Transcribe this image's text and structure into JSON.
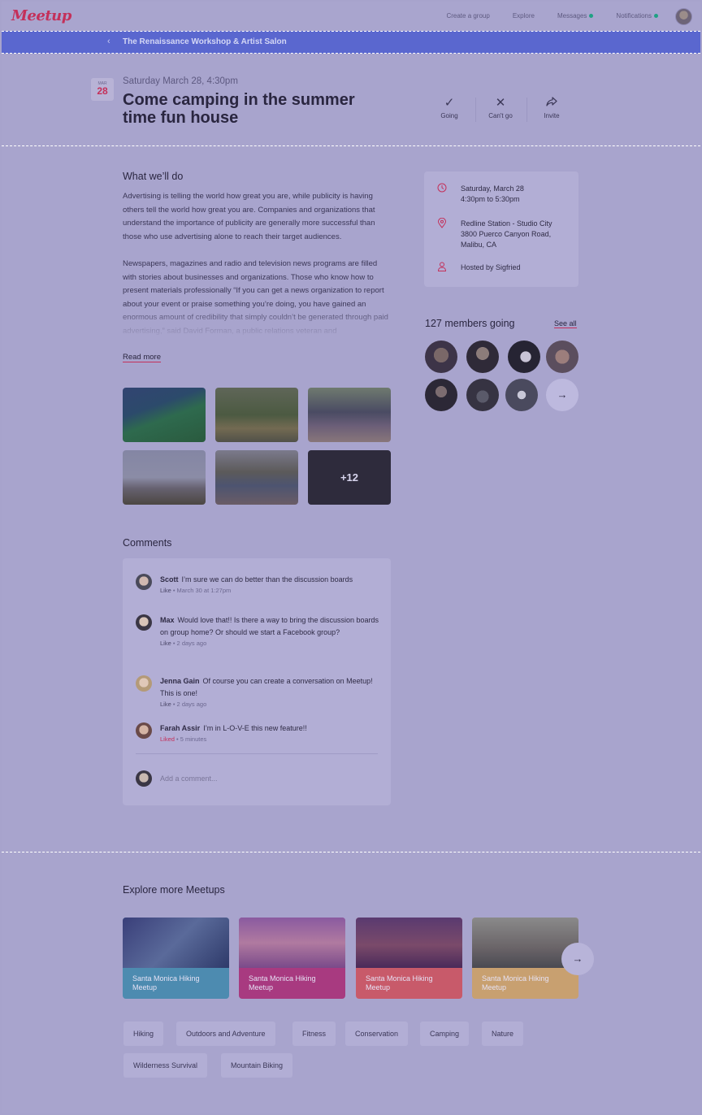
{
  "nav": {
    "logo": "Meetup",
    "links": [
      "Create a group",
      "Explore",
      "Messages",
      "Notifications"
    ]
  },
  "group": {
    "name": "The Renaissance Workshop & Artist Salon"
  },
  "event": {
    "cal_month": "MAR",
    "cal_day": "28",
    "date": "Saturday March 28, 4:30pm",
    "title": "Come camping in the summer time fun house",
    "rsvp": {
      "going": "Going",
      "cant_go": "Can't go",
      "invite": "Invite"
    }
  },
  "details": {
    "heading": "What we’ll do",
    "paragraphs": [
      "Advertising is telling the world how great you are, while publicity is having others tell the world how great you are. Companies and organizations that understand the importance of publicity are generally more successful than those who use advertising alone to reach their target audiences.",
      "Newspapers, magazines and radio and television news programs are filled with stories about businesses and organizations. Those who know how to present materials professionally “If you can get a news organization to report about your event or praise something you’re doing, you have gained an enormous amount of credibility that simply couldn’t be generated through paid advertising,” said David Forman, a public relations veteran and"
    ],
    "read_more": "Read more"
  },
  "photos": {
    "more_count": "+12"
  },
  "info": {
    "date_line1": "Saturday, March 28",
    "date_line2": "4:30pm to 5:30pm",
    "venue": "Redline Station - Studio City",
    "address1": "3800 Puerco Canyon Road,",
    "address2": "Malibu, CA",
    "host": "Hosted by Sigfried"
  },
  "members": {
    "heading": "127 members going",
    "see_all": "See all"
  },
  "comments": {
    "heading": "Comments",
    "items": [
      {
        "author": "Scott",
        "text": "I’m sure we can do better than the discussion boards",
        "like": "Like",
        "time": " • March 30 at 1:27pm"
      },
      {
        "author": "Max",
        "text": "Would love that!! Is there a way to bring the discussion boards on group home? Or should we start a Facebook group?",
        "like": "Like",
        "time": " • 2 days ago"
      },
      {
        "author": "Jenna Gain",
        "text": "Of course you can create a conversation on Meetup! This is one!",
        "like": "Like",
        "time": " • 2 days ago"
      },
      {
        "author": "Farah Assir",
        "text": "I’m in L-O-V-E this new feature!!",
        "like": "Liked",
        "time": " • 5 minutes"
      }
    ],
    "add_placeholder": "Add a comment..."
  },
  "explore": {
    "heading": "Explore more Meetups",
    "cards": [
      {
        "label": "Santa Monica Hiking Meetup"
      },
      {
        "label": "Santa Monica Hiking Meetup"
      },
      {
        "label": "Santa Monica Hiking Meetup"
      },
      {
        "label": "Santa Monica Hiking Meetup"
      }
    ],
    "tags": [
      "Hiking",
      "Outdoors and Adventure",
      "Fitness",
      "Conservation",
      "Camping",
      "Nature",
      "Wilderness Survival",
      "Mountain Biking"
    ]
  },
  "colors": {
    "brand": "#c4305a",
    "banner": "#5a67cf",
    "online_dot": "#1fa184"
  },
  "icons": [
    "check-icon",
    "close-icon",
    "share-icon",
    "clock-icon",
    "location-pin-icon",
    "person-icon",
    "arrow-right-icon",
    "chevron-left-icon"
  ]
}
